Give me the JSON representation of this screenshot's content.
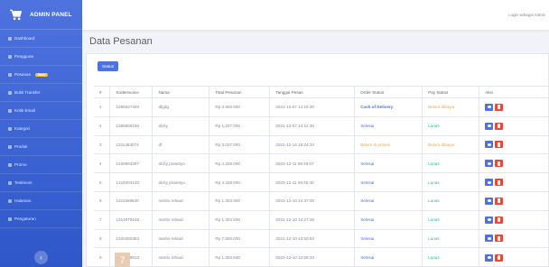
{
  "brand": "ADMIN PANEL",
  "sidebar": {
    "items": [
      {
        "label": "Dashboard"
      },
      {
        "label": "Pengguna"
      },
      {
        "label": "Pesanan",
        "badge": "Baru"
      },
      {
        "label": "Bukti Transfer"
      },
      {
        "label": "Kritik Email"
      },
      {
        "label": "Kategori"
      },
      {
        "label": "Produk"
      },
      {
        "label": "Promo"
      },
      {
        "label": "Testimoni"
      },
      {
        "label": "Halaman"
      },
      {
        "label": "Pengaturan"
      }
    ],
    "toggle": "‹"
  },
  "topbar": {
    "login_text": "Login sebagai Admin"
  },
  "page": {
    "title": "Data Pesanan",
    "status_button": "Status"
  },
  "table": {
    "headers": [
      "#",
      "KodeInvoice",
      "Nama",
      "Total Pesanan",
      "Tanggal Pesan",
      "Order Status",
      "Pay Status",
      "Aksi"
    ],
    "rows": [
      {
        "no": "1",
        "invoice": "1385627400",
        "nama": "dfgdg",
        "total": "Rp 3.900.000",
        "tanggal": "2021-12-07 14:16:40",
        "order": "Cash of Delivery",
        "order_style": "st-blue",
        "pay": "Belum dibayar",
        "pay_style": "st-orange"
      },
      {
        "no": "2",
        "invoice": "1388868150",
        "nama": "dicky",
        "total": "Rp 1.207.000",
        "tanggal": "2021-12-07 14:12:30",
        "order": "Selesai",
        "order_style": "st-link",
        "pay": "Lunas",
        "pay_style": "st-green"
      },
      {
        "no": "3",
        "invoice": "1311483074",
        "nama": "df",
        "total": "Rp 3.037.000",
        "tanggal": "2021-12-14 19:24:34",
        "order": "Belum di proses",
        "order_style": "st-orange",
        "pay": "Belum dibayar",
        "pay_style": "st-orange"
      },
      {
        "no": "4",
        "invoice": "1338993287",
        "nama": "dicky prasetyo",
        "total": "Rp 4.328.000",
        "tanggal": "2021-12-11 08:48:07",
        "order": "Selesai",
        "order_style": "st-link",
        "pay": "Lunas",
        "pay_style": "st-green"
      },
      {
        "no": "5",
        "invoice": "1318404140",
        "nama": "dicky prasetyo",
        "total": "Rp 4.328.000",
        "tanggal": "2021-12-11 08:45:40",
        "order": "Selesai",
        "order_style": "st-link",
        "pay": "Lunas",
        "pay_style": "st-green"
      },
      {
        "no": "6",
        "invoice": "1311598820",
        "nama": "rambo reload",
        "total": "Rp 1.303.500",
        "tanggal": "2021-12-10 14:37:00",
        "order": "Selesai",
        "order_style": "st-link",
        "pay": "Lunas",
        "pay_style": "st-green"
      },
      {
        "no": "7",
        "invoice": "1314978246",
        "nama": "rambo reload",
        "total": "Rp 1.303.500",
        "tanggal": "2021-12-10 14:27:28",
        "order": "Selesai",
        "order_style": "st-link",
        "pay": "Lunas",
        "pay_style": "st-green"
      },
      {
        "no": "8",
        "invoice": "1320450353",
        "nama": "rambo reload",
        "total": "Rp 7.500.000",
        "tanggal": "2021-12-10 13:50:53",
        "order": "Selesai",
        "order_style": "st-link",
        "pay": "Lunas",
        "pay_style": "st-green"
      },
      {
        "no": "9",
        "invoice": "1332159813",
        "nama": "rambo reload",
        "total": "Rp 1.303.500",
        "tanggal": "2021-12-10 12:58:33",
        "order": "Selesai",
        "order_style": "st-link",
        "pay": "Lunas",
        "pay_style": "st-green"
      }
    ]
  },
  "overlay_badge": "7",
  "colors": {
    "primary": "#4e73df",
    "danger": "#e74a3b",
    "warning": "#f6a23e",
    "success": "#1cc88a"
  }
}
